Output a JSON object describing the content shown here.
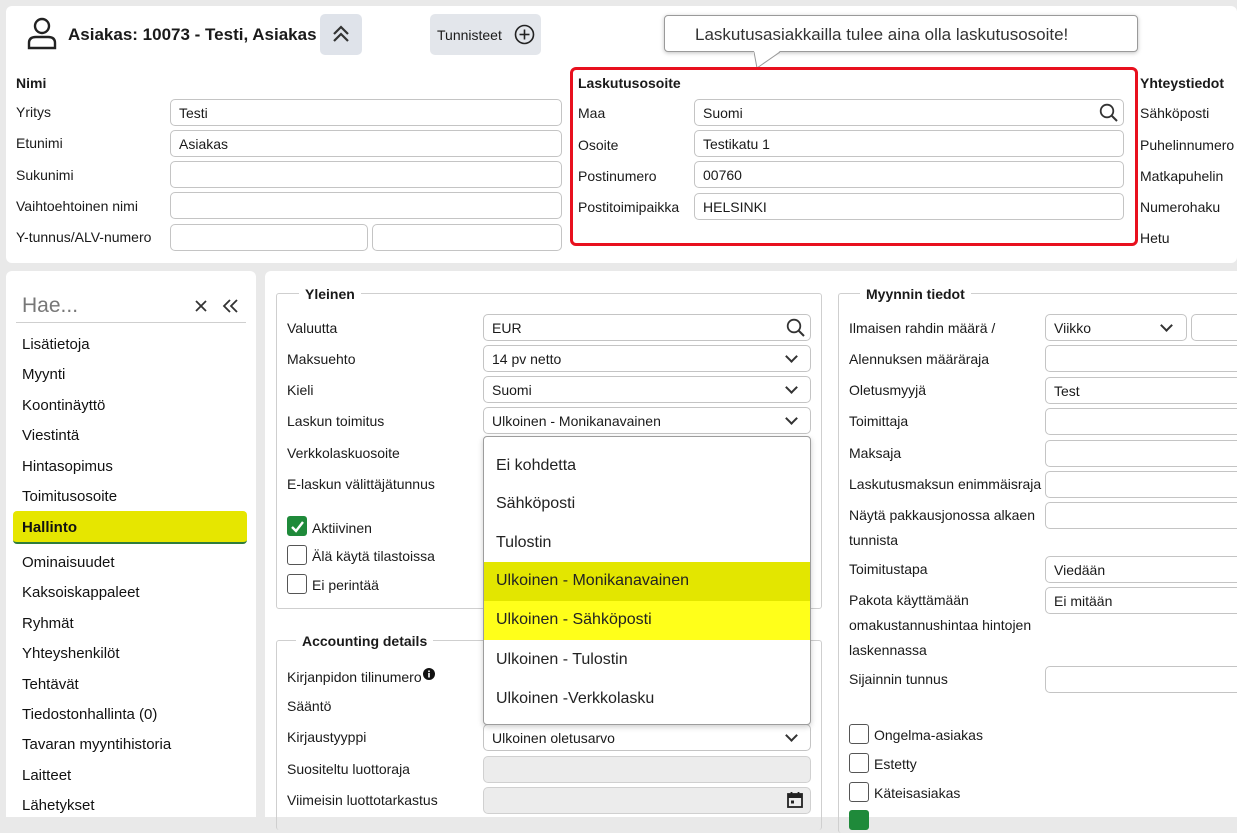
{
  "header": {
    "title": "Asiakas: 10073 - Testi, Asiakas",
    "tags_button": "Tunnisteet"
  },
  "tooltip": "Laskutusasiakkailla tulee aina olla laskutusosoite!",
  "name_section": {
    "heading": "Nimi",
    "company_label": "Yritys",
    "company_value": "Testi",
    "firstname_label": "Etunimi",
    "firstname_value": "Asiakas",
    "lastname_label": "Sukunimi",
    "lastname_value": "",
    "altname_label": "Vaihtoehtoinen nimi",
    "altname_value": "",
    "vat_label": "Y-tunnus/ALV-numero",
    "vat_value_1": "",
    "vat_value_2": ""
  },
  "billing": {
    "heading": "Laskutusosoite",
    "country_label": "Maa",
    "country_value": "Suomi",
    "address_label": "Osoite",
    "address_value": "Testikatu 1",
    "postal_label": "Postinumero",
    "postal_value": "00760",
    "city_label": "Postitoimipaikka",
    "city_value": "HELSINKI"
  },
  "contact": {
    "heading": "Yhteystiedot",
    "items": [
      "Sähköposti",
      "Puhelinnumero",
      "Matkapuhelin",
      "Numerohaku",
      "Hetu"
    ]
  },
  "sidebar": {
    "search_placeholder": "Hae...",
    "items": [
      "Lisätietoja",
      "Myynti",
      "Koontinäyttö",
      "Viestintä",
      "Hintasopimus",
      "Toimitusosoite",
      "Hallinto",
      "Ominaisuudet",
      "Kaksoiskappaleet",
      "Ryhmät",
      "Yhteyshenkilöt",
      "Tehtävät",
      "Tiedostonhallinta (0)",
      "Tavaran myyntihistoria",
      "Laitteet",
      "Lähetykset"
    ],
    "active_index": 6,
    "active_color": "#e6e600"
  },
  "general": {
    "heading": "Yleinen",
    "currency_label": "Valuutta",
    "currency_value": "EUR",
    "payterm_label": "Maksuehto",
    "payterm_value": "14 pv netto",
    "lang_label": "Kieli",
    "lang_value": "Suomi",
    "delivery_label": "Laskun toimitus",
    "delivery_value": "Ulkoinen - Monikanavainen",
    "einvoice_label": "Verkkolaskuosoite",
    "broker_label": "E-laskun välittäjätunnus",
    "active_label": "Aktiivinen",
    "nostats_label": "Älä käytä tilastoissa",
    "nocollect_label": "Ei perintää"
  },
  "dropdown": {
    "options": [
      "Ei kohdetta",
      "Sähköposti",
      "Tulostin",
      "Ulkoinen - Monikanavainen",
      "Ulkoinen - Sähköposti",
      "Ulkoinen - Tulostin",
      "Ulkoinen -Verkkolasku"
    ],
    "selected_index": 3,
    "hover_index": 4
  },
  "accounting": {
    "heading": "Accounting details",
    "account_label": "Kirjanpidon tilinumero",
    "rule_label": "Sääntö",
    "posting_label": "Kirjaustyyppi",
    "posting_value": "Ulkoinen oletusarvo",
    "credit_label": "Suositeltu luottoraja",
    "lastcheck_label": "Viimeisin luottotarkastus"
  },
  "sales": {
    "heading": "Myynnin tiedot",
    "freight_label": "Ilmaisen rahdin määrä /",
    "freight_period": "Viikko",
    "discount_label": "Alennuksen määräraja",
    "seller_label": "Oletusmyyjä",
    "seller_value": "Test",
    "supplier_label": "Toimittaja",
    "payer_label": "Maksaja",
    "fee_label": "Laskutusmaksun enimmäisraja",
    "packing_label_1": "Näytä pakkausjonossa alkaen",
    "packing_label_2": "tunnista",
    "delivery_label": "Toimitustapa",
    "delivery_value": "Viedään",
    "force_label_1": "Pakota käyttämään",
    "force_label_2": "omakustannushintaa hintojen",
    "force_label_3": "laskennassa",
    "force_value": "Ei mitään",
    "location_label": "Sijainnin tunnus",
    "problem_label": "Ongelma-asiakas",
    "blocked_label": "Estetty",
    "cash_label": "Käteisasiakas"
  },
  "colors": {
    "highlight_box": "#e8101e",
    "dropdown_selected": "#e3e600",
    "dropdown_hover": "#ffff1a"
  }
}
